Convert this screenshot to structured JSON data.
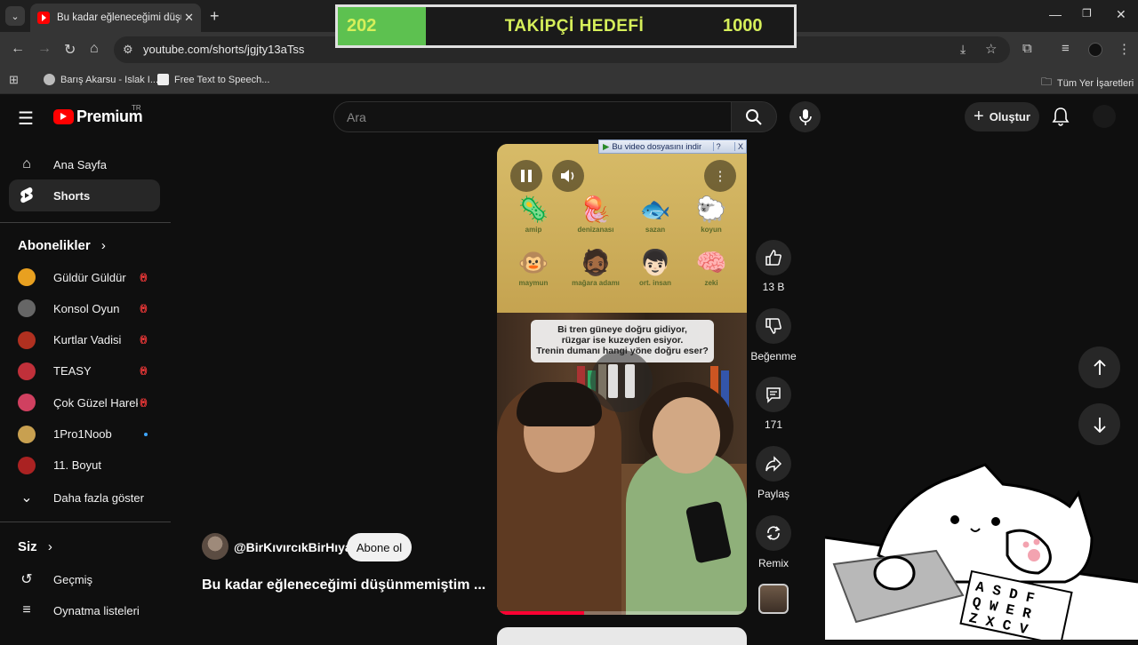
{
  "browser": {
    "tab_title": "Bu kadar eğleneceğimi düşünm",
    "new_tab": "+",
    "url": "youtube.com/shorts/jgjty13aTss",
    "bookmarks": [
      {
        "label": "Barış Akarsu - Islak I..."
      },
      {
        "label": "Free Text to Speech..."
      }
    ],
    "all_bookmarks": "Tüm Yer İşaretleri"
  },
  "goal_overlay": {
    "current": "202",
    "label": "TAKİPÇİ HEDEFİ",
    "target": "1000",
    "progress_fraction": 0.202,
    "fill_color": "#5dc150",
    "text_color": "#d6ef5a"
  },
  "masthead": {
    "logo": "Premium",
    "country": "TR",
    "search_placeholder": "Ara",
    "create_label": "Oluştur"
  },
  "sidebar": {
    "main": [
      {
        "label": "Ana Sayfa",
        "icon": "home-icon"
      },
      {
        "label": "Shorts",
        "icon": "shorts-icon",
        "active": true
      }
    ],
    "subscriptions_header": "Abonelikler",
    "subscriptions": [
      {
        "label": "Güldür Güldür",
        "status": "live",
        "color": "#e8a020"
      },
      {
        "label": "Konsol Oyun",
        "status": "live",
        "color": "#666666"
      },
      {
        "label": "Kurtlar Vadisi",
        "status": "live",
        "color": "#b03020"
      },
      {
        "label": "TEASY",
        "status": "live",
        "color": "#c0303a"
      },
      {
        "label": "Çok Güzel Harek...",
        "status": "live",
        "color": "#d04060"
      },
      {
        "label": "1Pro1Noob",
        "status": "new",
        "color": "#c8a050"
      },
      {
        "label": "11. Boyut",
        "status": "",
        "color": "#aa2222"
      }
    ],
    "show_more": "Daha fazla göster",
    "you_header": "Siz",
    "you_items": [
      {
        "label": "Geçmiş",
        "icon": "history-icon"
      },
      {
        "label": "Oynatma listeleri",
        "icon": "playlist-icon"
      }
    ]
  },
  "short": {
    "channel": "@BirKıvırcıkBirHıyar",
    "subscribe_label": "Abone ol",
    "title": "Bu kadar eğleneceğimi düşünmemiştim ...",
    "download_bar": "Bu video dosyasını indir",
    "download_bar_help": "?",
    "download_bar_close": "X",
    "emoji_row1": [
      {
        "emoji": "🦠",
        "caption": "amip"
      },
      {
        "emoji": "🪼",
        "caption": "denizanası"
      },
      {
        "emoji": "🐟",
        "caption": "sazan"
      },
      {
        "emoji": "🐑",
        "caption": "koyun"
      }
    ],
    "emoji_row2": [
      {
        "emoji": "🐵",
        "caption": "maymun"
      },
      {
        "emoji": "🧔🏾",
        "caption": "mağara adamı"
      },
      {
        "emoji": "👦🏻",
        "caption": "ort. insan"
      },
      {
        "emoji": "🧠",
        "caption": "zeki"
      }
    ],
    "riddle": "Bi tren güneye doğru gidiyor,\nrüzgar ise kuzeyden esiyor.\nTrenin dumanı hangi yöne doğru eser?",
    "progress_fraction": 0.35
  },
  "actions": {
    "like_count": "13 B",
    "dislike_label": "Beğenme",
    "comments_count": "171",
    "share_label": "Paylaş",
    "remix_label": "Remix"
  },
  "cat_overlay": {
    "keys": "ASDF QWER ZXCV"
  }
}
